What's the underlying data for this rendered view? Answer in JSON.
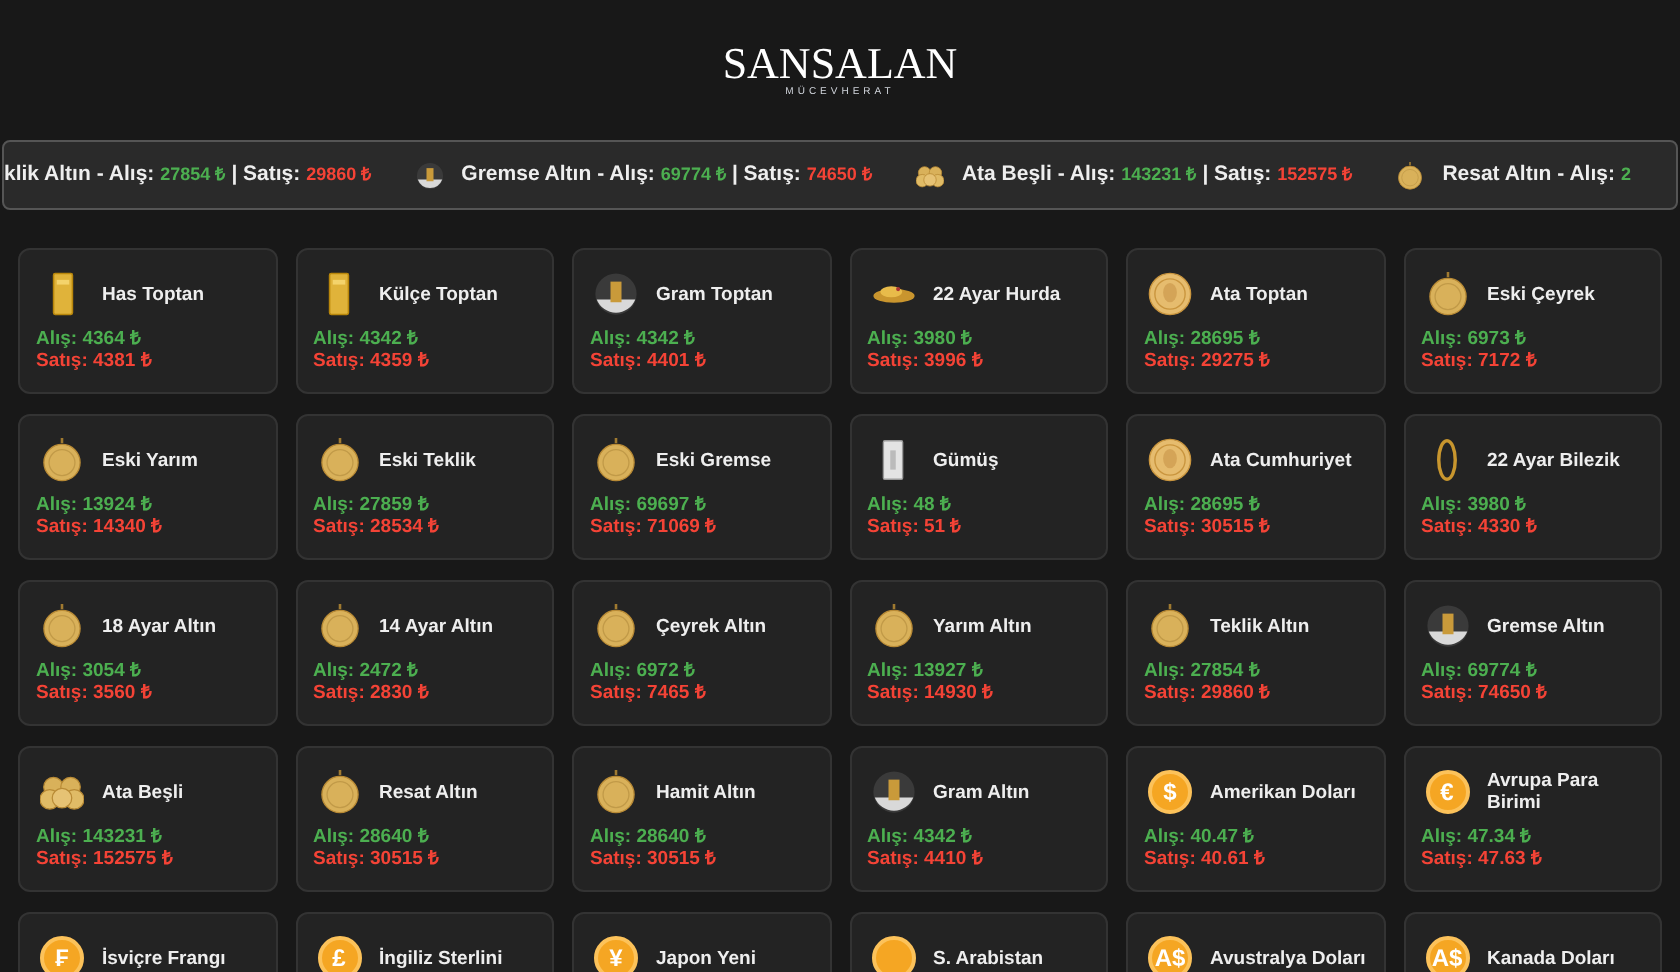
{
  "logo": {
    "name": "SANSALAN",
    "tagline": "MÜCEVHERAT"
  },
  "ticker": [
    {
      "kind": "none",
      "name": "klik Altın",
      "buy_label": "- Alış:",
      "buy": "27854 ₺",
      "sell_label": "| Satış:",
      "sell": "29860 ₺"
    },
    {
      "kind": "gram",
      "name": "Gremse Altın",
      "buy_label": "- Alış:",
      "buy": "69774 ₺",
      "sell_label": "| Satış:",
      "sell": "74650 ₺"
    },
    {
      "kind": "coins",
      "name": "Ata Beşli",
      "buy_label": "- Alış:",
      "buy": "143231 ₺",
      "sell_label": "| Satış:",
      "sell": "152575 ₺"
    },
    {
      "kind": "coin",
      "name": "Resat Altın",
      "buy_label": "- Alış:",
      "buy": "2"
    }
  ],
  "cards": [
    {
      "kind": "bar",
      "name": "Has Toptan",
      "buy": "Alış: 4364 ₺",
      "sell": "Satış: 4381 ₺"
    },
    {
      "kind": "bar",
      "name": "Külçe Toptan",
      "buy": "Alış: 4342 ₺",
      "sell": "Satış: 4359 ₺"
    },
    {
      "kind": "gram",
      "name": "Gram Toptan",
      "buy": "Alış: 4342 ₺",
      "sell": "Satış: 4401 ₺"
    },
    {
      "kind": "scrap",
      "name": "22 Ayar Hurda",
      "buy": "Alış: 3980 ₺",
      "sell": "Satış: 3996 ₺"
    },
    {
      "kind": "ata",
      "name": "Ata Toptan",
      "buy": "Alış: 28695 ₺",
      "sell": "Satış: 29275 ₺"
    },
    {
      "kind": "coin",
      "name": "Eski Çeyrek",
      "buy": "Alış: 6973 ₺",
      "sell": "Satış: 7172 ₺"
    },
    {
      "kind": "coin",
      "name": "Eski Yarım",
      "buy": "Alış: 13924 ₺",
      "sell": "Satış: 14340 ₺"
    },
    {
      "kind": "coin",
      "name": "Eski Teklik",
      "buy": "Alış: 27859 ₺",
      "sell": "Satış: 28534 ₺"
    },
    {
      "kind": "coin",
      "name": "Eski Gremse",
      "buy": "Alış: 69697 ₺",
      "sell": "Satış: 71069 ₺"
    },
    {
      "kind": "silver",
      "name": "Gümüş",
      "buy": "Alış: 48 ₺",
      "sell": "Satış: 51 ₺"
    },
    {
      "kind": "ata",
      "name": "Ata Cumhuriyet",
      "buy": "Alış: 28695 ₺",
      "sell": "Satış: 30515 ₺"
    },
    {
      "kind": "ring",
      "name": "22 Ayar Bilezik",
      "buy": "Alış: 3980 ₺",
      "sell": "Satış: 4330 ₺"
    },
    {
      "kind": "coin",
      "name": "18 Ayar Altın",
      "buy": "Alış: 3054 ₺",
      "sell": "Satış: 3560 ₺"
    },
    {
      "kind": "coin",
      "name": "14 Ayar Altın",
      "buy": "Alış: 2472 ₺",
      "sell": "Satış: 2830 ₺"
    },
    {
      "kind": "coin",
      "name": "Çeyrek Altın",
      "buy": "Alış: 6972 ₺",
      "sell": "Satış: 7465 ₺"
    },
    {
      "kind": "coin",
      "name": "Yarım Altın",
      "buy": "Alış: 13927 ₺",
      "sell": "Satış: 14930 ₺"
    },
    {
      "kind": "coin",
      "name": "Teklik Altın",
      "buy": "Alış: 27854 ₺",
      "sell": "Satış: 29860 ₺"
    },
    {
      "kind": "gram",
      "name": "Gremse Altın",
      "buy": "Alış: 69774 ₺",
      "sell": "Satış: 74650 ₺"
    },
    {
      "kind": "coins",
      "name": "Ata Beşli",
      "buy": "Alış: 143231 ₺",
      "sell": "Satış: 152575 ₺"
    },
    {
      "kind": "coin",
      "name": "Resat Altın",
      "buy": "Alış: 28640 ₺",
      "sell": "Satış: 30515 ₺"
    },
    {
      "kind": "coin",
      "name": "Hamit Altın",
      "buy": "Alış: 28640 ₺",
      "sell": "Satış: 30515 ₺"
    },
    {
      "kind": "gram",
      "name": "Gram Altın",
      "buy": "Alış: 4342 ₺",
      "sell": "Satış: 4410 ₺"
    },
    {
      "kind": "currency",
      "symbol": "$",
      "name": "Amerikan Doları",
      "buy": "Alış: 40.47 ₺",
      "sell": "Satış: 40.61 ₺"
    },
    {
      "kind": "currency",
      "symbol": "€",
      "name": "Avrupa Para Birimi",
      "buy": "Alış: 47.34 ₺",
      "sell": "Satış: 47.63 ₺"
    },
    {
      "kind": "currency",
      "symbol": "₣",
      "name": "İsviçre Frangı"
    },
    {
      "kind": "currency",
      "symbol": "£",
      "name": "İngiliz Sterlini"
    },
    {
      "kind": "currency",
      "symbol": "¥",
      "name": "Japon Yeni"
    },
    {
      "kind": "currency",
      "name": "S. Arabistan"
    },
    {
      "kind": "currency",
      "symbol": "A$",
      "name": "Avustralya Doları"
    },
    {
      "kind": "currency",
      "symbol": "A$",
      "name": "Kanada Doları"
    }
  ]
}
